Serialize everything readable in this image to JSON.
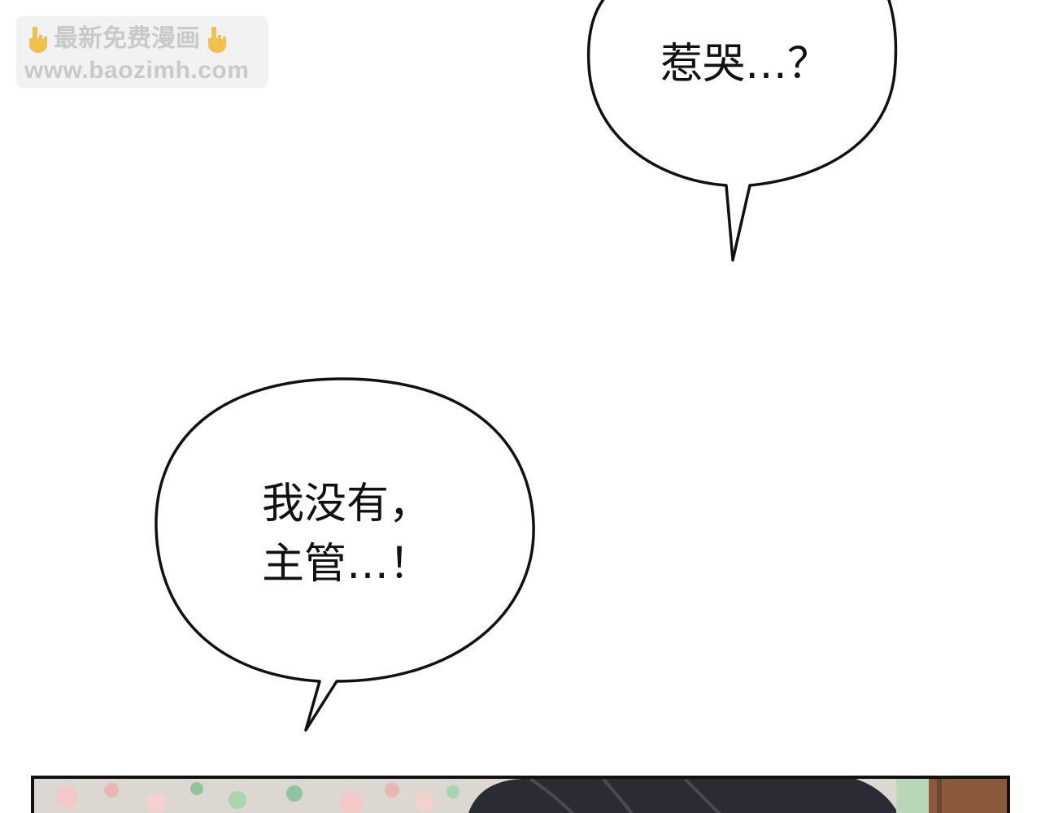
{
  "watermark": {
    "line1": "最新免费漫画",
    "line2": "www.baozimh.com",
    "icon": "pointing-down-hand-icon",
    "color": "#c9c9c9"
  },
  "bubbles": [
    {
      "lines": [
        "惹哭…？"
      ]
    },
    {
      "lines": [
        "我没有，",
        "主管…！"
      ]
    }
  ],
  "panel": {
    "border_color": "#111111"
  }
}
